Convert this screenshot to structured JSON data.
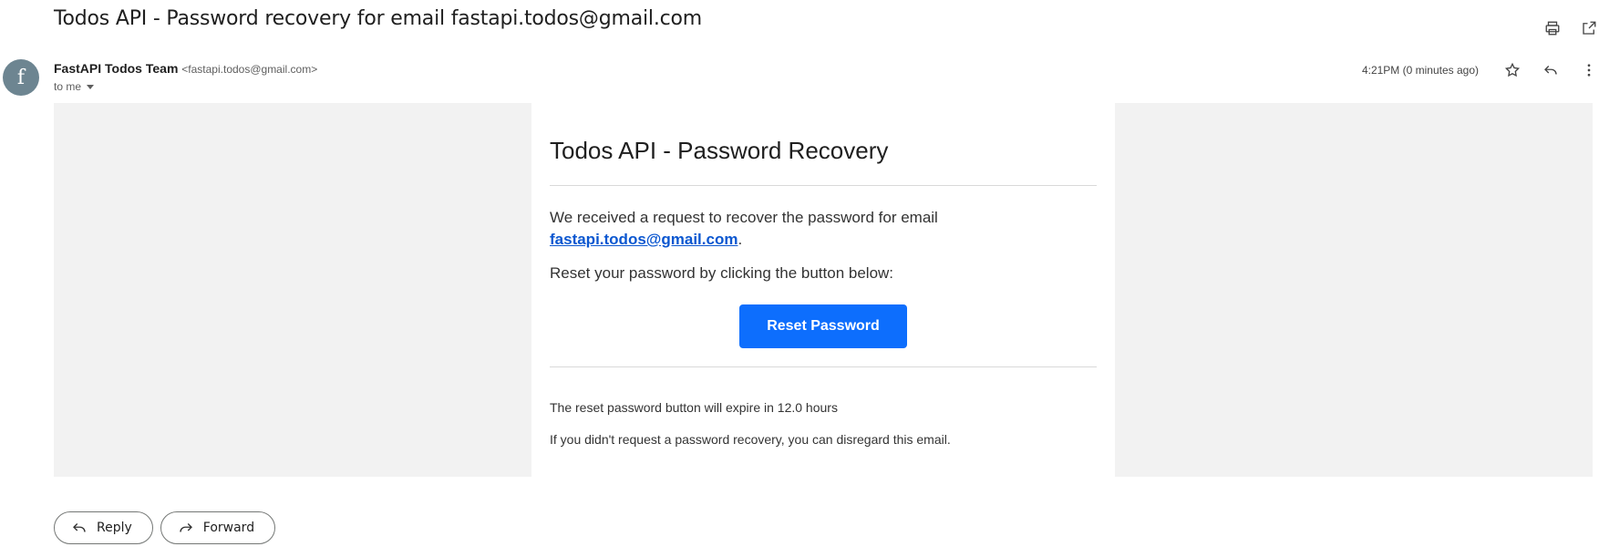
{
  "email": {
    "subject": "Todos API - Password recovery for email fastapi.todos@gmail.com",
    "sender_name": "FastAPI Todos Team",
    "sender_email": "<fastapi.todos@gmail.com>",
    "avatar_letter": "f",
    "to_label": "to me",
    "timestamp": "4:21PM (0 minutes ago)"
  },
  "icons": {
    "print": "print-icon",
    "open_new_window": "open-in-new-window-icon",
    "star": "star-icon",
    "reply": "reply-icon",
    "more": "more-vertical-icon"
  },
  "body": {
    "title": "Todos API - Password Recovery",
    "intro_text": "We received a request to recover the password for email",
    "email_link": "fastapi.todos@gmail.com",
    "period": ".",
    "instruction": "Reset your password by clicking the button below:",
    "button_label": "Reset Password",
    "expiry_note": "The reset password button will expire in 12.0 hours",
    "disregard_note": "If you didn't request a password recovery, you can disregard this email."
  },
  "actions": {
    "reply_label": "Reply",
    "forward_label": "Forward"
  },
  "colors": {
    "avatar": "#6d8591",
    "button": "#0d6efd",
    "link": "#0b57d0",
    "frame_bg": "#f2f2f2"
  }
}
